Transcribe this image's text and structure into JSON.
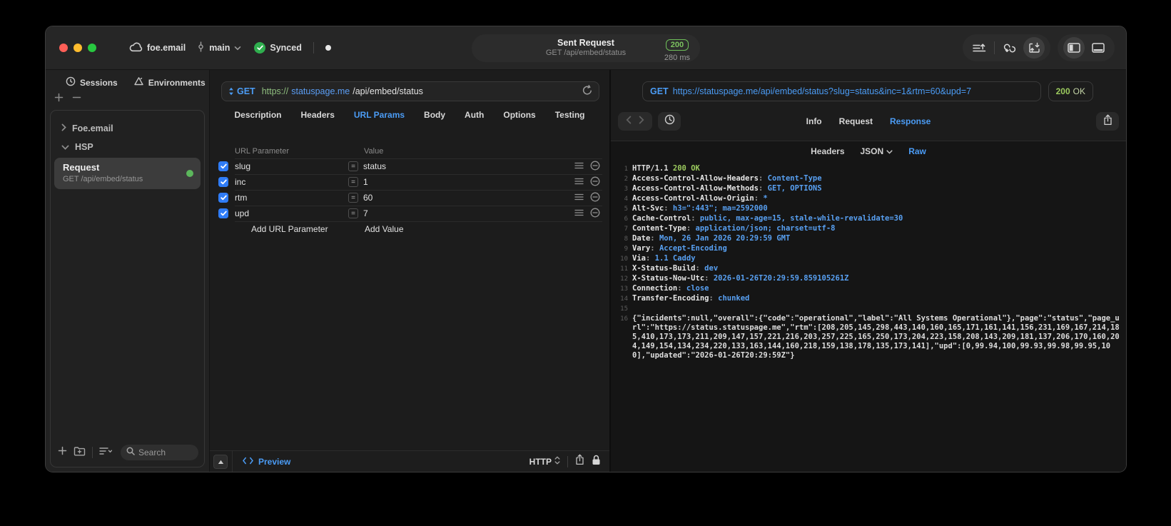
{
  "titlebar": {
    "workspace": "foe.email",
    "branch": "main",
    "sync_label": "Synced",
    "center": {
      "title": "Sent Request",
      "subtitle": "GET /api/embed/status",
      "status_code": "200",
      "duration": "280 ms"
    }
  },
  "sidebar": {
    "tabs": {
      "sessions": "Sessions",
      "environments": "Environments"
    },
    "groups": {
      "first": "Foe.email",
      "second": "HSP"
    },
    "request_item": {
      "title": "Request",
      "subtitle": "GET /api/embed/status"
    },
    "search_placeholder": "Search"
  },
  "request_editor": {
    "method": "GET",
    "url": {
      "scheme": "https://",
      "host": "statuspage.me",
      "path": "/api/embed/status"
    },
    "tabs": [
      "Description",
      "Headers",
      "URL Params",
      "Body",
      "Auth",
      "Options",
      "Testing"
    ],
    "active_tab": "URL Params",
    "params_table": {
      "col_param": "URL Parameter",
      "col_value": "Value",
      "rows": [
        {
          "name": "slug",
          "value": "status",
          "enabled": true
        },
        {
          "name": "inc",
          "value": "1",
          "enabled": true
        },
        {
          "name": "rtm",
          "value": "60",
          "enabled": true
        },
        {
          "name": "upd",
          "value": "7",
          "enabled": true
        }
      ],
      "add_param_placeholder": "Add URL Parameter",
      "add_value_placeholder": "Add Value"
    },
    "footer": {
      "preview_label": "Preview",
      "protocol": "HTTP"
    }
  },
  "response_viewer": {
    "request_summary": {
      "method": "GET",
      "url": "https://statuspage.me/api/embed/status?slug=status&inc=1&rtm=60&upd=7"
    },
    "status": {
      "code": "200",
      "text": "OK"
    },
    "tabs": [
      "Info",
      "Request",
      "Response"
    ],
    "active_tab": "Response",
    "subtabs": [
      "Headers",
      "JSON",
      "Raw"
    ],
    "active_subtab": "Raw",
    "code_lines": [
      {
        "n": "1",
        "parts": [
          [
            "plain",
            "HTTP/1.1 "
          ],
          [
            "status",
            "200 OK"
          ]
        ]
      },
      {
        "n": "2",
        "parts": [
          [
            "key",
            "Access-Control-Allow-Headers"
          ],
          [
            "sep",
            ": "
          ],
          [
            "val",
            "Content-Type"
          ]
        ]
      },
      {
        "n": "3",
        "parts": [
          [
            "key",
            "Access-Control-Allow-Methods"
          ],
          [
            "sep",
            ": "
          ],
          [
            "val",
            "GET, OPTIONS"
          ]
        ]
      },
      {
        "n": "4",
        "parts": [
          [
            "key",
            "Access-Control-Allow-Origin"
          ],
          [
            "sep",
            ": "
          ],
          [
            "val",
            "*"
          ]
        ]
      },
      {
        "n": "5",
        "parts": [
          [
            "key",
            "Alt-Svc"
          ],
          [
            "sep",
            ": "
          ],
          [
            "val",
            "h3=\":443\"; ma=2592000"
          ]
        ]
      },
      {
        "n": "6",
        "parts": [
          [
            "key",
            "Cache-Control"
          ],
          [
            "sep",
            ": "
          ],
          [
            "val",
            "public, max-age=15, stale-while-revalidate=30"
          ]
        ]
      },
      {
        "n": "7",
        "parts": [
          [
            "key",
            "Content-Type"
          ],
          [
            "sep",
            ": "
          ],
          [
            "val",
            "application/json; charset=utf-8"
          ]
        ]
      },
      {
        "n": "8",
        "parts": [
          [
            "key",
            "Date"
          ],
          [
            "sep",
            ": "
          ],
          [
            "val",
            "Mon, 26 Jan 2026 20:29:59 GMT"
          ]
        ]
      },
      {
        "n": "9",
        "parts": [
          [
            "key",
            "Vary"
          ],
          [
            "sep",
            ": "
          ],
          [
            "val",
            "Accept-Encoding"
          ]
        ]
      },
      {
        "n": "10",
        "parts": [
          [
            "key",
            "Via"
          ],
          [
            "sep",
            ": "
          ],
          [
            "val",
            "1.1 Caddy"
          ]
        ]
      },
      {
        "n": "11",
        "parts": [
          [
            "key",
            "X-Status-Build"
          ],
          [
            "sep",
            ": "
          ],
          [
            "val",
            "dev"
          ]
        ]
      },
      {
        "n": "12",
        "parts": [
          [
            "key",
            "X-Status-Now-Utc"
          ],
          [
            "sep",
            ": "
          ],
          [
            "val",
            "2026-01-26T20:29:59.859105261Z"
          ]
        ]
      },
      {
        "n": "13",
        "parts": [
          [
            "key",
            "Connection"
          ],
          [
            "sep",
            ": "
          ],
          [
            "val",
            "close"
          ]
        ]
      },
      {
        "n": "14",
        "parts": [
          [
            "key",
            "Transfer-Encoding"
          ],
          [
            "sep",
            ": "
          ],
          [
            "val",
            "chunked"
          ]
        ]
      },
      {
        "n": "15",
        "parts": []
      },
      {
        "n": "16",
        "parts": [
          [
            "plain",
            "{\"incidents\":null,\"overall\":{\"code\":\"operational\",\"label\":\"All Systems Operational\"},\"page\":\"status\",\"page_url\":\"https://status.statuspage.me\",\"rtm\":[208,205,145,298,443,140,160,165,171,161,141,156,231,169,167,214,185,410,173,173,211,209,147,157,221,216,203,257,225,165,250,173,204,223,158,208,143,209,181,137,206,170,160,204,149,154,134,234,220,133,163,144,160,218,159,138,178,135,173,141],\"upd\":[0,99.94,100,99.93,99.98,99.95,100],\"updated\":\"2026-01-26T20:29:59Z\"}"
          ]
        ]
      }
    ]
  },
  "colors": {
    "accent_blue": "#4b9cf5",
    "status_green": "#9ccb5e",
    "checkbox_blue": "#2f7cf6",
    "request_dot_green": "#5cb75c",
    "traffic_red": "#ff5f57",
    "traffic_yellow": "#febc2e",
    "traffic_green": "#28c840"
  }
}
